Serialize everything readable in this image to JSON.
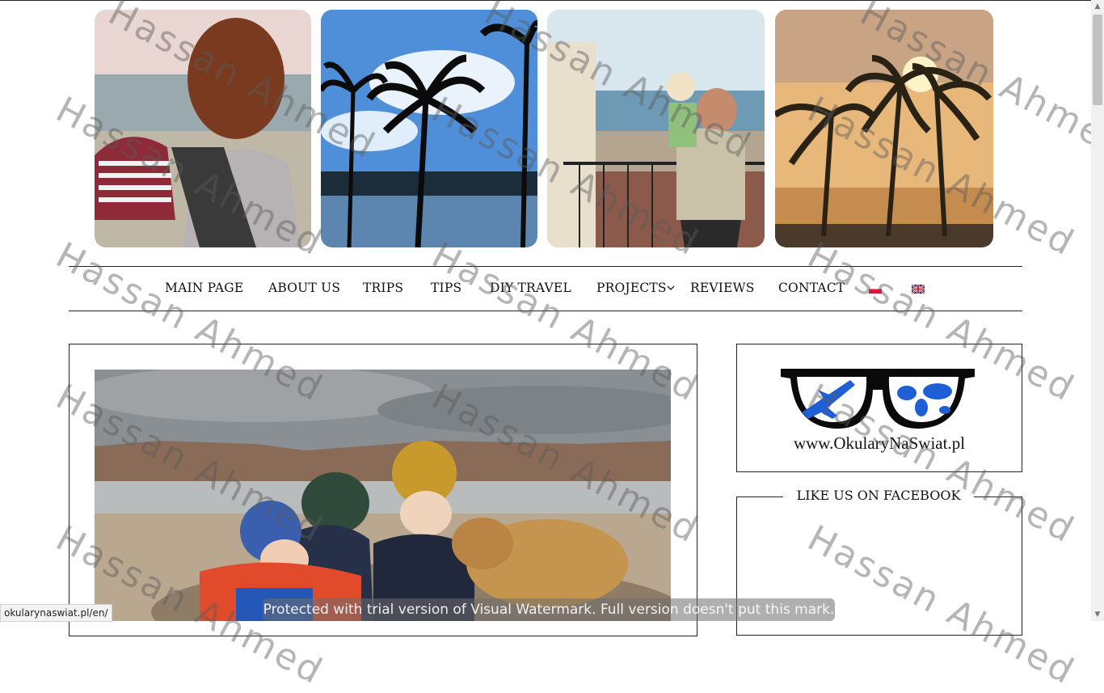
{
  "nav": {
    "items": [
      {
        "label": "MAIN PAGE"
      },
      {
        "label": "ABOUT US"
      },
      {
        "label": "TRIPS"
      },
      {
        "label": "TIPS"
      },
      {
        "label": "DIY TRAVEL"
      },
      {
        "label": "PROJECTS"
      },
      {
        "label": "REVIEWS"
      },
      {
        "label": "CONTACT"
      }
    ],
    "dropdown_icon": "chevron-down-icon",
    "languages": [
      {
        "name": "polish-flag-icon"
      },
      {
        "name": "english-flag-icon"
      }
    ]
  },
  "sidebar": {
    "logo_url": "www.OkularyNaSwiat.pl",
    "facebook_title": "LIKE US ON FACEBOOK"
  },
  "watermark": {
    "text": "Hassan Ahmed",
    "trial_notice": "Protected with trial version of Visual Watermark. Full version doesn't put this mark."
  },
  "status_bar": {
    "url": "okularynaswiat.pl/en/"
  },
  "colors": {
    "accent": "#1e5fd6",
    "border": "#222222"
  }
}
